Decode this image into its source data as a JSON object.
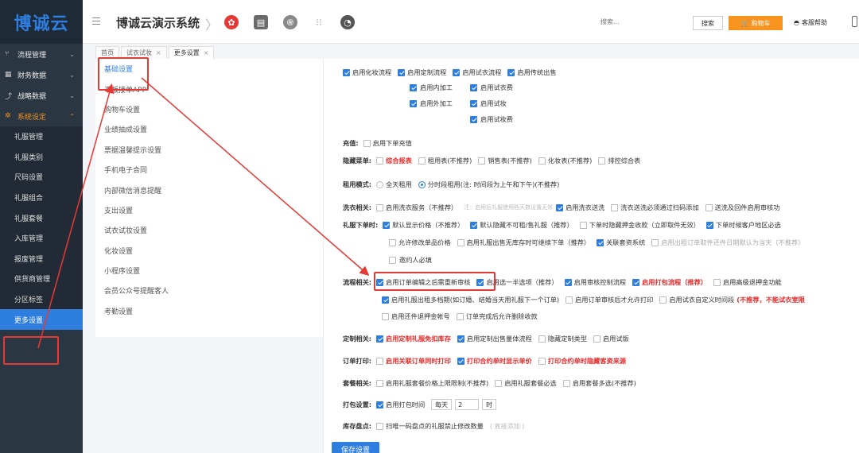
{
  "header": {
    "logo": "博诚云",
    "title": "博诚云演示系统",
    "search_placeholder": "搜索...",
    "search_button": "搜索",
    "cart_button": "购物车",
    "help": "客服帮助"
  },
  "sidebar": {
    "groups": [
      {
        "label": "流程管理",
        "icon": "flow-icon"
      },
      {
        "label": "财务数据",
        "icon": "finance-icon"
      },
      {
        "label": "战略数据",
        "icon": "chart-icon"
      },
      {
        "label": "系统设定",
        "icon": "gear-icon"
      }
    ],
    "sub_items": [
      "礼服管理",
      "礼服类别",
      "尺码设置",
      "礼服组合",
      "礼服套餐",
      "入库管理",
      "报废管理",
      "供货商管理",
      "分区标签",
      "更多设置"
    ]
  },
  "tabs": [
    {
      "label": "首页",
      "closable": false
    },
    {
      "label": "试衣试妆",
      "closable": true
    },
    {
      "label": "更多设置",
      "closable": true
    }
  ],
  "subnav": [
    "基础设置",
    "平板接单APP",
    "购物车设置",
    "业绩抽成设置",
    "票据温馨提示设置",
    "手机电子合同",
    "内部微信消息提醒",
    "支出设置",
    "试衣试妆设置",
    "化妆设置",
    "小程序设置",
    "会员公众号提醒客人",
    "考勤设置"
  ],
  "settings": {
    "top_row": [
      "启用化妆流程",
      "启用定制流程",
      "启用试衣流程",
      "启用传统出售"
    ],
    "sub_col1": [
      "启用内加工",
      "启用外加工"
    ],
    "sub_col2": [
      "启用试衣费",
      "启用试妆",
      "启用试妆费"
    ],
    "recharge": {
      "label": "充值:",
      "opt": "启用下单充值"
    },
    "hide_menu": {
      "label": "隐藏菜单:",
      "opts": [
        "综合报表",
        "租用表(不推荐)",
        "销售表(不推荐)",
        "化妆表(不推荐)",
        "排控综合表"
      ]
    },
    "rent_mode": {
      "label": "租用模式:",
      "opts": [
        "全天租用",
        "分时段租用(注: 时间段为上午和下午)(不推荐)"
      ]
    },
    "wash": {
      "label": "洗衣相关:",
      "opt1": "启用洗衣服务（不推荐）",
      "note": "注：启用后礼服使用档天数设置无效",
      "opt2": "启用洗衣送洗",
      "opt3": "洗衣送洗必须通过扫码添加",
      "opt4": "送洗及回件启用审核功"
    },
    "order": {
      "label": "礼服下单时:",
      "row1": [
        "默认显示价格（不推荐）",
        "默认隐藏不可租/售礼服（推荐）",
        "下单时隐藏押金收款（立即取件无效）",
        "下单时候客户地区必选"
      ],
      "row2": [
        "允许修改单品价格",
        "启用礼服出售无库存时可继续下单（推荐）",
        "关联套资系统",
        "启用出租订单取件还件日期默认为当天（不推荐）"
      ],
      "row3": "邀约人必填"
    },
    "process": {
      "label": "流程相关:",
      "row1": [
        "启用订单编辑之后需重新审核",
        "启用选一半选项（推荐）",
        "启用审核控制流程",
        "启用打包流程（推荐）",
        "启用高级退押金功能"
      ],
      "row2": [
        "启用礼服出租多档期(如订婚、结婚当天用礼服下一个订单)",
        "启用订单审核后才允许打印",
        "启用试衣自定义时间段",
        "(不推荐，不能试衣室限"
      ],
      "row3": [
        "启用还件退押金帐号",
        "订单完成后允许删除收款"
      ]
    },
    "custom": {
      "label": "定制相关:",
      "opts": [
        "启用定制礼服免扣库存",
        "启用定制出售量体流程",
        "隐藏定制类型",
        "启用试版"
      ]
    },
    "print": {
      "label": "订单打印:",
      "opts": [
        "启用关联订单同时打印",
        "打印合约单时显示单价",
        "打印合约单时隐藏客资来源"
      ]
    },
    "package": {
      "label": "套餐相关:",
      "opts": [
        "启用礼服套餐价格上限限制(不推荐)",
        "启用礼服套餐必选",
        "启用套餐多选(不推荐)"
      ]
    },
    "pack": {
      "label": "打包设置:",
      "opt": "启用打包时间",
      "each": "每天",
      "value": "2",
      "unit": "时"
    },
    "inventory": {
      "label": "库存盘点:",
      "opt": "扫唯一码盘点的礼服禁止修改数量",
      "note": "( 直接添加 )"
    },
    "save": "保存设置"
  },
  "colors": {
    "accent": "#2e7ee0",
    "orange": "#f7931e",
    "red": "#e52b2b",
    "sidebar": "#2b3643"
  }
}
